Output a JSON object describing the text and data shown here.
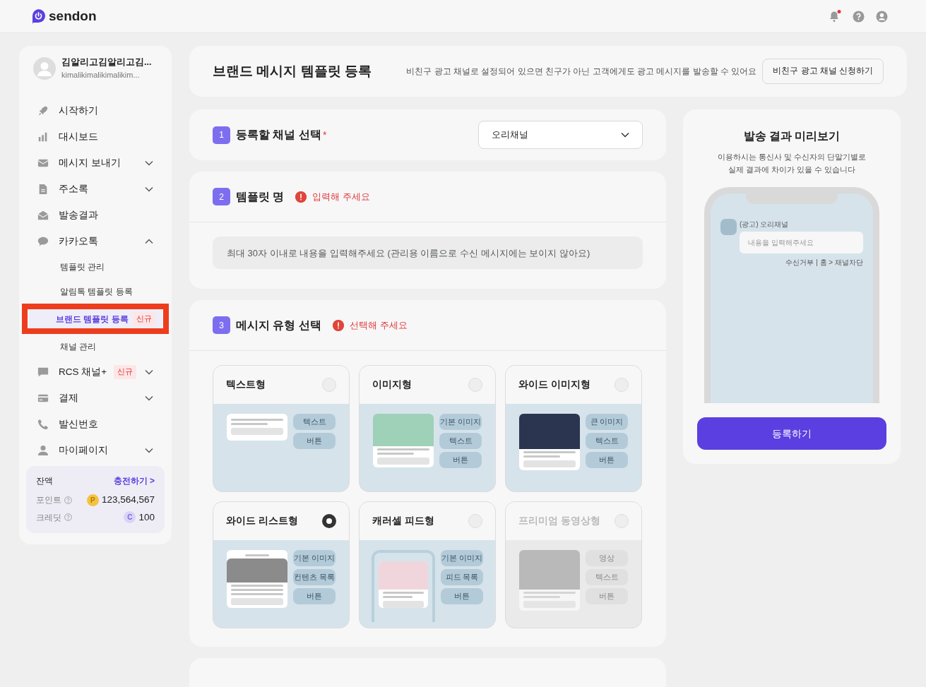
{
  "header": {
    "logo": "sendon",
    "notification_unread": true
  },
  "sidebar": {
    "profile": {
      "name": "김알리고김알리고김...",
      "email": "kimalikimalikimalikim..."
    },
    "items": [
      {
        "label": "시작하기"
      },
      {
        "label": "대시보드"
      },
      {
        "label": "메시지 보내기",
        "expanded": false
      },
      {
        "label": "주소록",
        "expanded": false
      },
      {
        "label": "발송결과"
      },
      {
        "label": "카카오톡",
        "expanded": true,
        "children": [
          {
            "label": "템플릿 관리",
            "selected": false
          },
          {
            "label": "알림톡 템플릿 등록",
            "selected": false
          },
          {
            "label": "브랜드 템플릿 등록",
            "selected": true,
            "badge": "신규"
          },
          {
            "label": "채널 관리",
            "selected": false
          }
        ]
      },
      {
        "label": "RCS 채널+",
        "badge": "신규",
        "expanded": false
      },
      {
        "label": "결제",
        "expanded": false
      },
      {
        "label": "발신번호"
      },
      {
        "label": "마이페이지",
        "expanded": false
      }
    ],
    "balance": {
      "title": "잔액",
      "charge_link": "충전하기 >",
      "points_label": "포인트",
      "points_symbol": "P",
      "points": "123,564,567",
      "credit_label": "크레딧",
      "credit_symbol": "C",
      "credit": "100"
    }
  },
  "title_card": {
    "title": "브랜드 메시지 템플릿 등록",
    "notice": "비친구 광고 채널로 설정되어 있으면 친구가 아닌 고객에게도 광고 메시지를 발송할 수 있어요",
    "button": "비친구 광고 채널 신청하기"
  },
  "step1": {
    "number": "1",
    "title": "등록할 채널 선택",
    "required_mark": "*",
    "select_value": "오리채널"
  },
  "step2": {
    "number": "2",
    "title": "템플릿 명",
    "error": "입력해 주세요",
    "placeholder": "최대 30자 이내로 내용을 입력해주세요 (관리용 이름으로 수신 메시지에는 보이지 않아요)"
  },
  "step3": {
    "number": "3",
    "title": "메시지 유형 선택",
    "error": "선택해 주세요",
    "options": [
      {
        "label": "텍스트형",
        "kind": "text",
        "selected": false,
        "disabled": false,
        "chips": [
          "텍스트",
          "버튼"
        ]
      },
      {
        "label": "이미지형",
        "kind": "image",
        "selected": false,
        "disabled": false,
        "chips": [
          "기본 이미지",
          "텍스트",
          "버튼"
        ]
      },
      {
        "label": "와이드 이미지형",
        "kind": "wide",
        "selected": false,
        "disabled": false,
        "chips": [
          "큰 이미지",
          "텍스트",
          "버튼"
        ]
      },
      {
        "label": "와이드 리스트형",
        "kind": "list",
        "selected": true,
        "disabled": false,
        "chips": [
          "기본 이미지",
          "컨텐츠 목록",
          "버튼"
        ]
      },
      {
        "label": "캐러셀 피드형",
        "kind": "carousel",
        "selected": false,
        "disabled": false,
        "chips": [
          "기본 이미지",
          "피드 목록",
          "버튼"
        ]
      },
      {
        "label": "프리미엄 동영상형",
        "kind": "video",
        "selected": false,
        "disabled": true,
        "chips": [
          "영상",
          "텍스트",
          "버튼"
        ]
      }
    ]
  },
  "preview": {
    "title": "발송 결과 미리보기",
    "description": [
      "이용하시는 통신사 및 수신자의 단말기별로",
      "실제 결과에 차이가 있을 수 있습니다"
    ],
    "channel": "(광고) 오리채널",
    "message_placeholder": "내용을 입력해주세요",
    "footer": "수신거부 | 홈 > 채널차단",
    "button": "등록하기"
  }
}
